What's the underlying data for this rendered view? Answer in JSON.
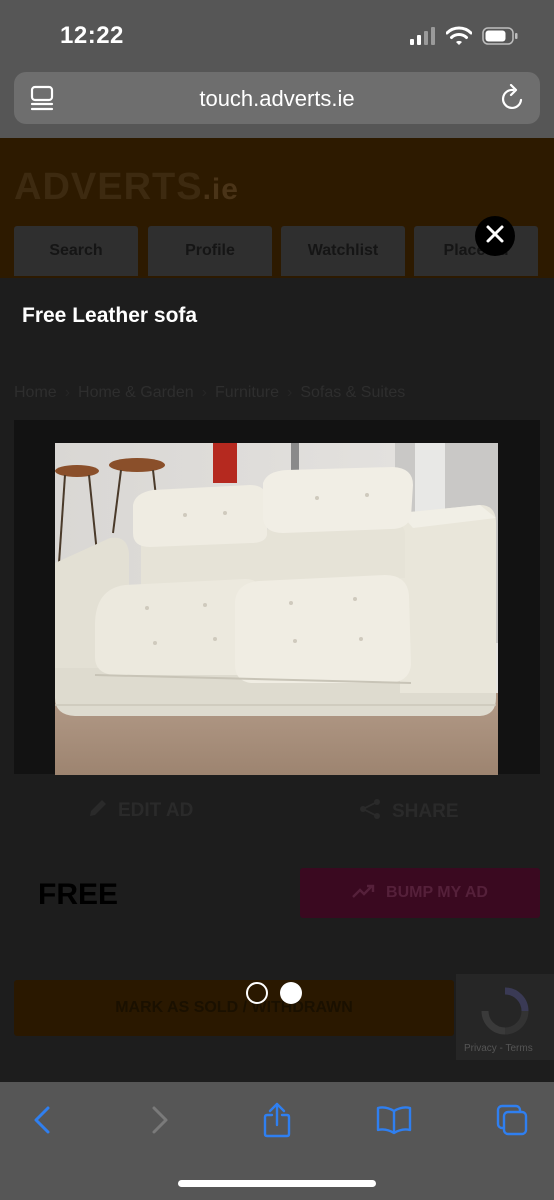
{
  "status_bar": {
    "time": "12:22",
    "icons": [
      "cellular-signal-icon",
      "wifi-icon",
      "battery-icon"
    ]
  },
  "browser": {
    "url": "touch.adverts.ie",
    "reader_icon": "reader-mode-icon",
    "reload_icon": "reload-icon"
  },
  "site": {
    "logo_main": "ADVERTS",
    "logo_suffix": ".ie",
    "nav": [
      {
        "label": "Search"
      },
      {
        "label": "Profile"
      },
      {
        "label": "Watchlist"
      },
      {
        "label": "Place ad"
      }
    ],
    "ad_title": "Free Leather sofa",
    "breadcrumb": [
      "Home",
      "Home & Garden",
      "Furniture",
      "Sofas & Suites"
    ],
    "edit_label": "EDIT AD",
    "share_label": "SHARE",
    "price": "FREE",
    "bump_label": "BUMP MY AD",
    "mark_label": "MARK AS SOLD / WITHDRAWN",
    "recaptcha_text": "Privacy - Terms"
  },
  "lightbox": {
    "close_icon": "close-icon",
    "image_subject": "white leather two-seat sofa",
    "page_count": 2,
    "current_page": 2
  },
  "toolbar": {
    "buttons": [
      "back-icon",
      "forward-icon",
      "share-icon",
      "bookmarks-icon",
      "tabs-icon"
    ]
  },
  "colors": {
    "chrome_gray": "#565656",
    "ios_blue": "#2f7ff0",
    "brand_orange_dimmed": "#2d1a00"
  }
}
